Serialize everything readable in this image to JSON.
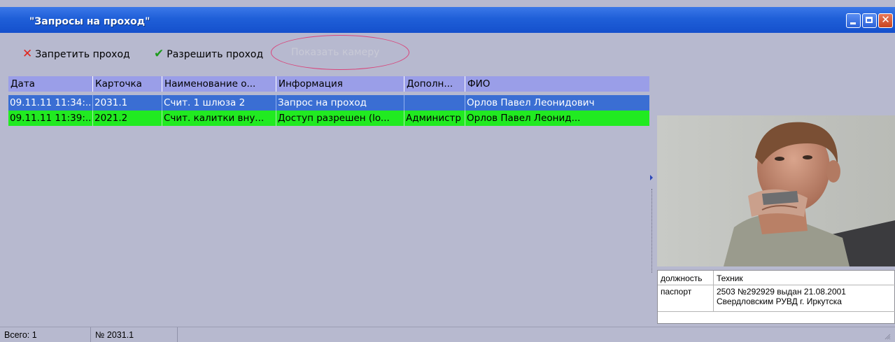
{
  "window": {
    "title": "\"Запросы на проход\""
  },
  "toolbar": {
    "deny_label": "Запретить проход",
    "allow_label": "Разрешить проход",
    "camera_label": "Показать камеру",
    "deny_icon": "cross-icon",
    "allow_icon": "checkmark-icon"
  },
  "table": {
    "columns": [
      "Дата",
      "Карточка",
      "Наименование о...",
      "Информация",
      "Дополн...",
      "ФИО"
    ],
    "rows": [
      [
        "09.11.11 11:34:...",
        "2031.1",
        "Счит. 1 шлюза 2",
        "Запрос на проход",
        "",
        "Орлов Павел Леонидович"
      ],
      [
        "09.11.11 11:39:...",
        "2021.2",
        "Счит. калитки вну...",
        "Доступ разрешен (lo...",
        "Администр",
        "Орлов Павел Леонид..."
      ]
    ]
  },
  "info": {
    "position_key": "должность",
    "position_value": "Техник",
    "passport_key": "паспорт",
    "passport_line1": "2503 №292929 выдан 21.08.2001",
    "passport_line2": "Свердловским РУВД г. Иркутска"
  },
  "status": {
    "total": "Всего: 1",
    "card": "№ 2031.1"
  },
  "colors": {
    "selected_row": "#3a6ed3",
    "allowed_row": "#21ea21",
    "header": "#9a9ee8",
    "background": "#b7b9cf",
    "titlebar": "#1f5fd8"
  }
}
